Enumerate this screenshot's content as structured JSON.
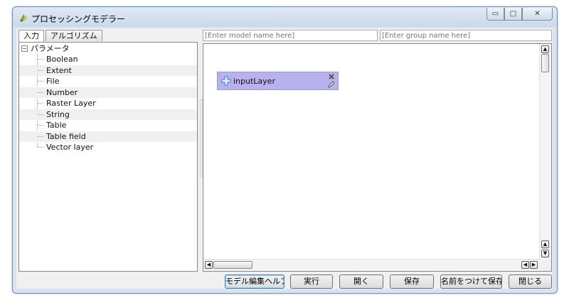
{
  "window": {
    "title": "プロセッシングモデラー",
    "controls": {
      "minimize": "▭",
      "maximize": "□",
      "close": "✕"
    }
  },
  "left_panel": {
    "tabs": [
      {
        "label": "入力",
        "active": true
      },
      {
        "label": "アルゴリズム",
        "active": false
      }
    ],
    "tree": {
      "root_label": "パラメータ",
      "expander": "−",
      "items": [
        "Boolean",
        "Extent",
        "File",
        "Number",
        "Raster Layer",
        "String",
        "Table",
        "Table field",
        "Vector layer"
      ]
    }
  },
  "model_name": {
    "placeholder": "[Enter model name here]"
  },
  "group_name": {
    "placeholder": "[Enter group name here]"
  },
  "canvas": {
    "nodes": [
      {
        "label": "inputLayer",
        "icon": "plus-icon",
        "color": "#b7b2ee"
      }
    ]
  },
  "scrollbars": {
    "up": "▲",
    "down": "▼",
    "left": "◀",
    "right": "▶"
  },
  "buttons": {
    "help": "モデル編集ヘルプ",
    "run": "実行",
    "open": "開く",
    "save": "保存",
    "save_as": "名前をつけて保存..",
    "close": "閉じる"
  },
  "colors": {
    "node_fill": "#b7b2ee",
    "titlebar": "#c9d9ec"
  }
}
